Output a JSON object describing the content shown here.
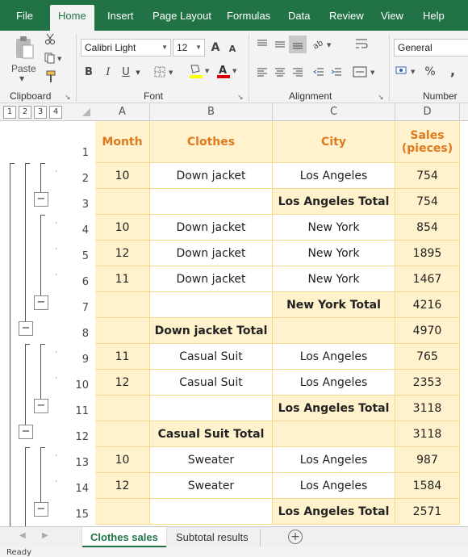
{
  "menu": {
    "tabs": [
      "File",
      "Home",
      "Insert",
      "Page Layout",
      "Formulas",
      "Data",
      "Review",
      "View",
      "Help"
    ],
    "active": "Home"
  },
  "ribbon": {
    "clipboard_label": "Clipboard",
    "paste_label": "Paste",
    "font_label": "Font",
    "font_name": "Calibri Light",
    "font_size": "12",
    "alignment_label": "Alignment",
    "number_label": "Number",
    "number_format": "General",
    "bold": "B",
    "italic": "I",
    "underline": "U",
    "grow_font": "A",
    "shrink_font": "A",
    "percent": "%",
    "comma": ","
  },
  "outline_levels": [
    "1",
    "2",
    "3",
    "4"
  ],
  "columns": [
    "A",
    "B",
    "C",
    "D"
  ],
  "header_row": {
    "row_num": "1",
    "month": "Month",
    "clothes": "Clothes",
    "city": "City",
    "sales": "Sales (pieces)"
  },
  "rows": [
    {
      "num": "2",
      "month": "10",
      "clothes": "Down jacket",
      "city": "Los Angeles",
      "sales": "754",
      "bold_city": false,
      "bold_clothes": false
    },
    {
      "num": "3",
      "month": "",
      "clothes": "",
      "city": "Los Angeles Total",
      "sales": "754",
      "bold_city": true,
      "bold_clothes": false
    },
    {
      "num": "4",
      "month": "10",
      "clothes": "Down jacket",
      "city": "New York",
      "sales": "854",
      "bold_city": false,
      "bold_clothes": false
    },
    {
      "num": "5",
      "month": "12",
      "clothes": "Down jacket",
      "city": "New York",
      "sales": "1895",
      "bold_city": false,
      "bold_clothes": false
    },
    {
      "num": "6",
      "month": "11",
      "clothes": "Down jacket",
      "city": "New York",
      "sales": "1467",
      "bold_city": false,
      "bold_clothes": false
    },
    {
      "num": "7",
      "month": "",
      "clothes": "",
      "city": "New York Total",
      "sales": "4216",
      "bold_city": true,
      "bold_clothes": false
    },
    {
      "num": "8",
      "month": "",
      "clothes": "Down jacket Total",
      "city": "",
      "sales": "4970",
      "bold_city": false,
      "bold_clothes": true
    },
    {
      "num": "9",
      "month": "11",
      "clothes": "Casual Suit",
      "city": "Los Angeles",
      "sales": "765",
      "bold_city": false,
      "bold_clothes": false
    },
    {
      "num": "10",
      "month": "12",
      "clothes": "Casual Suit",
      "city": "Los Angeles",
      "sales": "2353",
      "bold_city": false,
      "bold_clothes": false
    },
    {
      "num": "11",
      "month": "",
      "clothes": "",
      "city": "Los Angeles Total",
      "sales": "3118",
      "bold_city": true,
      "bold_clothes": false
    },
    {
      "num": "12",
      "month": "",
      "clothes": "Casual Suit Total",
      "city": "",
      "sales": "3118",
      "bold_city": false,
      "bold_clothes": true
    },
    {
      "num": "13",
      "month": "10",
      "clothes": "Sweater",
      "city": "Los Angeles",
      "sales": "987",
      "bold_city": false,
      "bold_clothes": false
    },
    {
      "num": "14",
      "month": "12",
      "clothes": "Sweater",
      "city": "Los Angeles",
      "sales": "1584",
      "bold_city": false,
      "bold_clothes": false
    },
    {
      "num": "15",
      "month": "",
      "clothes": "",
      "city": "Los Angeles Total",
      "sales": "2571",
      "bold_city": true,
      "bold_clothes": false
    }
  ],
  "sheet_tabs": [
    "Clothes sales",
    "Subtotal results"
  ],
  "active_sheet": "Clothes sales",
  "add_sheet": "+",
  "status": "Ready",
  "colors": {
    "accent": "#217346",
    "cell_fill": "#fff2cc",
    "header_text": "#e07a1f",
    "grid_line": "#f5d98c"
  }
}
